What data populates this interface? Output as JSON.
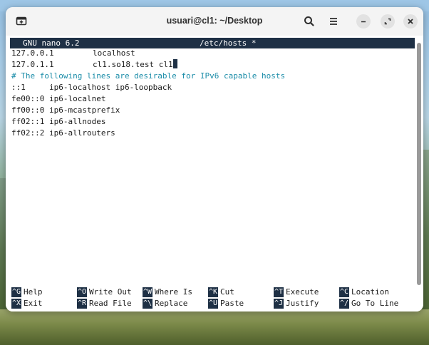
{
  "window": {
    "title": "usuari@cl1: ~/Desktop"
  },
  "icons": {
    "new_tab": "terminal-new-tab-icon",
    "search": "search-icon",
    "menu": "hamburger-menu-icon",
    "minimize": "minimize-icon",
    "maximize": "maximize-icon",
    "close": "close-icon"
  },
  "nano": {
    "version": "GNU nano 6.2",
    "filename": "/etc/hosts *"
  },
  "buffer": {
    "hosts": [
      {
        "address": "127.0.0.1",
        "names": "localhost"
      },
      {
        "address": "127.0.1.1",
        "names": "cl1.so18.test cl1"
      }
    ],
    "comment": "# The following lines are desirable for IPv6 capable hosts",
    "ipv6_lines": [
      "::1     ip6-localhost ip6-loopback",
      "fe00::0 ip6-localnet",
      "ff00::0 ip6-mcastprefix",
      "ff02::1 ip6-allnodes",
      "ff02::2 ip6-allrouters"
    ]
  },
  "shortcuts": {
    "row1": [
      {
        "key": "^G",
        "label": "Help"
      },
      {
        "key": "^O",
        "label": "Write Out"
      },
      {
        "key": "^W",
        "label": "Where Is"
      },
      {
        "key": "^K",
        "label": "Cut"
      },
      {
        "key": "^T",
        "label": "Execute"
      },
      {
        "key": "^C",
        "label": "Location"
      }
    ],
    "row2": [
      {
        "key": "^X",
        "label": "Exit"
      },
      {
        "key": "^R",
        "label": "Read File"
      },
      {
        "key": "^\\",
        "label": "Replace"
      },
      {
        "key": "^U",
        "label": "Paste"
      },
      {
        "key": "^J",
        "label": "Justify"
      },
      {
        "key": "^/",
        "label": "Go To Line"
      }
    ]
  },
  "colors": {
    "header_bg": "#1e3045",
    "comment": "#1a8ca8",
    "titlebar": "#f4f4f4"
  }
}
